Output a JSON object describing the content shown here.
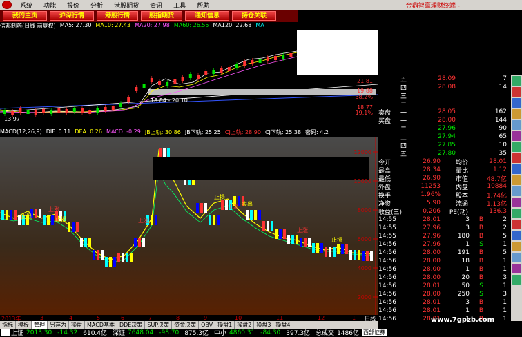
{
  "menubar": {
    "items": [
      "系统",
      "功能",
      "报价",
      "分析",
      "港股期货",
      "资讯",
      "工具",
      "帮助"
    ],
    "app_title": "金鼎智赢理财终端 -"
  },
  "navbar": {
    "buttons": [
      "我的主页",
      "沪深行情",
      "港股行情",
      "股指期货",
      "通知信息",
      "持仓关联"
    ]
  },
  "kline_info": {
    "stock": "信邦制药(日线 前复权)",
    "ma5": "MA5: 27.30",
    "ma10": "MA10: 27.43",
    "ma20": "MA20: 27.98",
    "ma60": "MA60: 26.55",
    "ma120": "MA120: 22.68",
    "ma_last": "MA"
  },
  "kline_prices": {
    "p1": "21.81",
    "p2": "19.88",
    "p3": "18.77",
    "pct1": "38.2%",
    "pct2": "19.1%",
    "low_label": "13.97",
    "range_label": "18.84 - 20.10"
  },
  "macd_info": {
    "macd_label": "MACD(12,26,9)",
    "dif": "DIF: 0.11",
    "dea": "DEA: 0.26",
    "macd": "MACD: -0.29",
    "jb_up": "JB上轨: 30.86",
    "jb_down": "JB下轨: 25.25",
    "cj_up": "CJ上轨: 28.90",
    "cj_down": "CJ下轨: 25.38",
    "secret": "密码: 4.2"
  },
  "macd_axis": [
    "12000",
    "10000",
    "8000",
    "6000",
    "4000",
    "2000"
  ],
  "annotations": [
    "止损",
    "上涨",
    "止损",
    "上涨",
    "止损",
    "上涨",
    "卖出",
    "上涨",
    "止损"
  ],
  "xaxis": {
    "labels": [
      "2013年",
      "3",
      "4",
      "5",
      "6",
      "7",
      "8",
      "9",
      "10",
      "11",
      "12",
      "1"
    ],
    "right_label": "日线"
  },
  "quote": {
    "sell": [
      {
        "lvl": "五",
        "p": "28.09",
        "v": "7"
      },
      {
        "lvl": "四",
        "p": "28.08",
        "v": "14"
      },
      {
        "lvl": "三",
        "p": "",
        "v": ""
      },
      {
        "lvl": "二",
        "p": "",
        "v": ""
      },
      {
        "lvl": "一",
        "p": "28.05",
        "v": "162"
      }
    ],
    "sell_label": "卖盘",
    "buy_label": "买盘",
    "buy": [
      {
        "lvl": "一",
        "p": "28.00",
        "v": "144"
      },
      {
        "lvl": "二",
        "p": "27.96",
        "v": "90"
      },
      {
        "lvl": "三",
        "p": "27.94",
        "v": "65"
      },
      {
        "lvl": "四",
        "p": "27.85",
        "v": "10"
      },
      {
        "lvl": "五",
        "p": "27.80",
        "v": "35"
      }
    ],
    "stats": [
      [
        "今开",
        "26.90",
        "均价",
        "28.01"
      ],
      [
        "最高",
        "28.34",
        "量比",
        "1.12"
      ],
      [
        "最低",
        "26.90",
        "市值",
        "48.7亿"
      ],
      [
        "外盘",
        "11253",
        "内盘",
        "10884"
      ],
      [
        "换手",
        "1.96%",
        "股本",
        "1.74亿"
      ],
      [
        "净资",
        "5.90",
        "流通",
        "1.13亿"
      ],
      [
        "收益(三)",
        "0.206",
        "PE(动)",
        "136.3"
      ]
    ],
    "ticks": [
      [
        "14:55",
        "28.01",
        "3",
        "B",
        "2"
      ],
      [
        "14:55",
        "27.96",
        "3",
        "B",
        "2"
      ],
      [
        "14:55",
        "27.96",
        "180",
        "B",
        "5"
      ],
      [
        "14:56",
        "27.96",
        "1",
        "S",
        "1"
      ],
      [
        "14:56",
        "28.00",
        "191",
        "B",
        "5"
      ],
      [
        "14:56",
        "28.00",
        "18",
        "B",
        "1"
      ],
      [
        "14:56",
        "28.00",
        "1",
        "B",
        "1"
      ],
      [
        "14:56",
        "28.00",
        "20",
        "B",
        "3"
      ],
      [
        "14:56",
        "28.01",
        "50",
        "S",
        "1"
      ],
      [
        "14:56",
        "28.00",
        "250",
        "S",
        "3"
      ],
      [
        "14:56",
        "28.01",
        "3",
        "B",
        "1"
      ],
      [
        "14:56",
        "28.01",
        "1",
        "B",
        "1"
      ],
      [
        "14:56",
        "28.01",
        "1",
        "B",
        "1"
      ]
    ]
  },
  "bottom_tabs": [
    "指标",
    "模板",
    "管理",
    "另存为",
    "操盘",
    "MACD基本",
    "DDE决策",
    "SUP决策",
    "资金决策",
    "OBV",
    "操盘1",
    "操盘2",
    "操盘3",
    "操盘4"
  ],
  "sub_tabs": [
    "扩展区",
    "关联报价"
  ],
  "status": {
    "sh_label": "上证",
    "sh_val": "2013.30",
    "sh_chg": "-14.32",
    "sh_amt": "610.4亿",
    "sz_label": "深证",
    "sz_val": "7648.04",
    "sz_chg": "-98.70",
    "sz_amt": "875.3亿",
    "zx_label": "中小",
    "zx_val": "4860.31",
    "zx_chg": "-84.30",
    "zx_amt": "397.3亿",
    "vol_label": "总成交",
    "vol_val": "1486亿",
    "broker": "西部证券",
    "watermark": "www.7gpzb.com"
  },
  "colors": {
    "up": "#ff3333",
    "down": "#00e600",
    "accent": "#ffff00"
  }
}
